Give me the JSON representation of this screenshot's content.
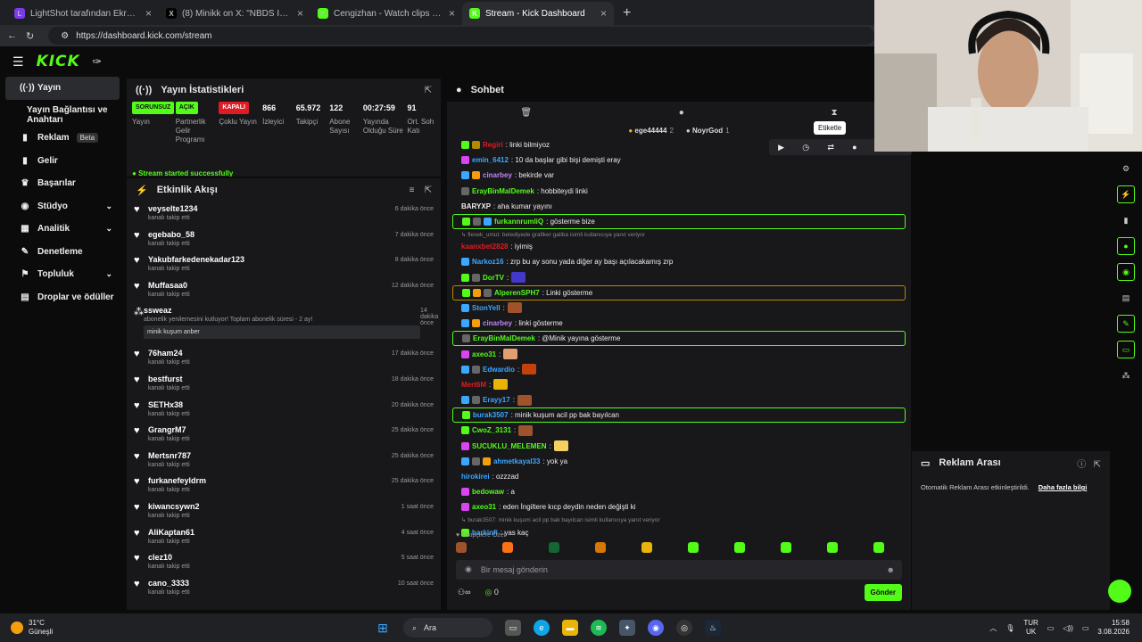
{
  "browser": {
    "tabs": [
      {
        "title": "LightShot tarafından Ekran Görünt",
        "fav": "L",
        "color": "#7c3aed",
        "active": false
      },
      {
        "title": "(8) Minikk on X: \"NBDS İFŞA ;) http",
        "fav": "X",
        "color": "#000000",
        "active": false
      },
      {
        "title": "Cengizhan - Watch clips on Kick",
        "fav": "K",
        "color": "#53fc18",
        "active": false
      },
      {
        "title": "Stream - Kick Dashboard",
        "fav": "K",
        "color": "#53fc18",
        "active": true
      }
    ],
    "url": "https://dashboard.kick.com/stream"
  },
  "header": {
    "logo": "KICK"
  },
  "sidebar": {
    "items": [
      {
        "label": "Yayın",
        "icon": "broadcast-icon",
        "glyph": "((·))",
        "active": true
      },
      {
        "label": "Yayın Bağlantısı ve Anahtarı",
        "icon": "",
        "glyph": "",
        "sub": true
      },
      {
        "label": "Reklam",
        "icon": "ad-icon",
        "glyph": "▮",
        "badge": "Beta"
      },
      {
        "label": "Gelir",
        "icon": "revenue-icon",
        "glyph": "▮"
      },
      {
        "label": "Başarılar",
        "icon": "trophy-icon",
        "glyph": "♛"
      },
      {
        "label": "Stüdyo",
        "icon": "studio-icon",
        "glyph": "◉",
        "chev": true
      },
      {
        "label": "Analitik",
        "icon": "analytics-icon",
        "glyph": "▦",
        "chev": true
      },
      {
        "label": "Denetleme",
        "icon": "moderation-icon",
        "glyph": "✎"
      },
      {
        "label": "Topluluk",
        "icon": "community-icon",
        "glyph": "⚑",
        "chev": true
      },
      {
        "label": "Droplar ve ödüller",
        "icon": "drops-icon",
        "glyph": "▤"
      }
    ]
  },
  "stats": {
    "title": "Yayın İstatistikleri",
    "items": [
      {
        "value": "SORUNSUZ",
        "label": "Yayın",
        "pill": "g"
      },
      {
        "value": "AÇIK",
        "label": "Partnerlik Gelir Programı",
        "pill": "g"
      },
      {
        "value": "KAPALI",
        "label": "Çoklu Yayın",
        "pill": "r"
      },
      {
        "value": "866",
        "label": "İzleyici"
      },
      {
        "value": "65.972",
        "label": "Takipçi"
      },
      {
        "value": "122",
        "label": "Abone Sayısı"
      },
      {
        "value": "00:27:59",
        "label": "Yayında Olduğu Süre"
      },
      {
        "value": "91",
        "label": "Ort. Soh Katı"
      }
    ],
    "status": "Stream started successfully"
  },
  "activity": {
    "title": "Etkinlik Akışı",
    "items": [
      {
        "name": "veyselte1234",
        "sub": "kanalı takip etti",
        "time": "6 dakika önce"
      },
      {
        "name": "egebabo_58",
        "sub": "kanalı takip etti",
        "time": "7 dakika önce"
      },
      {
        "name": "Yakubfarkedenekadar123",
        "sub": "kanalı takip etti",
        "time": "8 dakika önce"
      },
      {
        "name": "Muffasaa0",
        "sub": "kanalı takip etti",
        "time": "12 dakika önce"
      },
      {
        "name": "ssweaz",
        "sub": "abonelik yenilemesini kutluyor! Toplam abonelik süresi - 2 ay!",
        "time": "14 dakika önce",
        "box": "minik kuşum anber",
        "star": true
      },
      {
        "name": "76ham24",
        "sub": "kanalı takip etti",
        "time": "17 dakika önce"
      },
      {
        "name": "bestfurst",
        "sub": "kanalı takip etti",
        "time": "18 dakika önce"
      },
      {
        "name": "SETHx38",
        "sub": "kanalı takip etti",
        "time": "20 dakika önce"
      },
      {
        "name": "GrangrM7",
        "sub": "kanalı takip etti",
        "time": "25 dakika önce"
      },
      {
        "name": "Mertsnr787",
        "sub": "kanalı takip etti",
        "time": "25 dakika önce"
      },
      {
        "name": "furkanefeyldrm",
        "sub": "kanalı takip etti",
        "time": "25 dakika önce"
      },
      {
        "name": "kiwancsywn2",
        "sub": "kanalı takip etti",
        "time": "1 saat önce"
      },
      {
        "name": "AliKaptan61",
        "sub": "kanalı takip etti",
        "time": "4 saat önce"
      },
      {
        "name": "clez10",
        "sub": "kanalı takip etti",
        "time": "5 saat önce"
      },
      {
        "name": "cano_3333",
        "sub": "kanalı takip etti",
        "time": "10 saat önce"
      }
    ]
  },
  "chat": {
    "title": "Sohbet",
    "pinned": [
      {
        "name": "ege44444",
        "count": "2"
      },
      {
        "name": "NoyrGod",
        "count": "1"
      }
    ],
    "tooltip": "Etiketle",
    "messages": [
      {
        "user": "Regiri",
        "color": "#e01b24",
        "text": ": linki bilmiyoz",
        "badges": [
          "#53fc18",
          "#b48a00"
        ]
      },
      {
        "user": "emin_6412",
        "color": "#3ba7ff",
        "text": ": 10 da başlar gibi bişi demişti eray",
        "badges": [
          "#d946ef"
        ]
      },
      {
        "user": "cinarbey",
        "color": "#c084fc",
        "text": ": bekirde var",
        "badges": [
          "#3ba7ff",
          "#f59e0b"
        ]
      },
      {
        "user": "ErayBinMalDemek",
        "color": "#53fc18",
        "text": ": hobbiteydi linki",
        "badges": [
          "#666"
        ]
      },
      {
        "user": "BARYXP",
        "color": "#eee",
        "text": ": aha kumar yayını",
        "badges": []
      },
      {
        "user": "furkannrumliQ",
        "color": "#53fc18",
        "text": ": gösterme bize",
        "badges": [
          "#53fc18",
          "#666",
          "#3ba7ff"
        ],
        "hl": "hl"
      },
      {
        "sys": "↳ flesek_umut: belediyede grafiker galiba isimli kullanıcıya yanıt veriyor"
      },
      {
        "user": "kaanxbet2828",
        "color": "#e01b24",
        "text": ": iyimiş",
        "badges": []
      },
      {
        "user": "Narkoz16",
        "color": "#3ba7ff",
        "text": ": zrp bu ay sonu yada diğer ay başı açılacakamış zrp",
        "badges": [
          "#3ba7ff"
        ]
      },
      {
        "user": "DorTV",
        "color": "#53fc18",
        "text": ":",
        "badges": [
          "#53fc18",
          "#666"
        ],
        "emote": "#4338ca"
      },
      {
        "user": "AlperenSPH7",
        "color": "#53fc18",
        "text": ": Linki gösterme",
        "badges": [
          "#53fc18",
          "#f59e0b",
          "#666"
        ],
        "hl": "ylw"
      },
      {
        "user": "StonYell",
        "color": "#3ba7ff",
        "text": ":",
        "badges": [
          "#3ba7ff"
        ],
        "emote": "#a0522d"
      },
      {
        "user": "cinarbey",
        "color": "#c084fc",
        "text": ": linki gösterme",
        "badges": [
          "#3ba7ff",
          "#f59e0b"
        ]
      },
      {
        "user": "ErayBinMalDemek",
        "color": "#53fc18",
        "text": ": @Minik yayına gösterme",
        "badges": [
          "#666"
        ],
        "hl": "hl"
      },
      {
        "user": "axeo31",
        "color": "#53fc18",
        "text": ":",
        "badges": [
          "#d946ef"
        ],
        "emote": "#e0a070"
      },
      {
        "user": "Edwardio",
        "color": "#3ba7ff",
        "text": ":",
        "badges": [
          "#3ba7ff",
          "#666"
        ],
        "emote": "#c2410c"
      },
      {
        "user": "Mert6M",
        "color": "#e01b24",
        "text": ":",
        "badges": [],
        "emote": "#eab308"
      },
      {
        "user": "Erayy17",
        "color": "#3ba7ff",
        "text": ":",
        "badges": [
          "#3ba7ff",
          "#666"
        ],
        "emote": "#a0522d"
      },
      {
        "user": "burak3507",
        "color": "#3ba7ff",
        "text": ": minik kuşum acil pp bak bayılcan",
        "badges": [
          "#53fc18"
        ],
        "hl": "hl"
      },
      {
        "user": "CwoZ_3131",
        "color": "#53fc18",
        "text": ":",
        "badges": [
          "#53fc18"
        ],
        "emote": "#a0522d"
      },
      {
        "user": "SUCUKLU_MELEMEN",
        "color": "#53fc18",
        "text": ":",
        "badges": [
          "#d946ef"
        ],
        "emote": "#f5d061"
      },
      {
        "user": "ahmetkayal33",
        "color": "#3ba7ff",
        "text": ": yok ya",
        "badges": [
          "#3ba7ff",
          "#666",
          "#f59e0b"
        ]
      },
      {
        "user": "hirokirei",
        "color": "#3ba7ff",
        "text": ": ozzzad",
        "badges": []
      },
      {
        "user": "bedowaw",
        "color": "#53fc18",
        "text": ": a",
        "badges": [
          "#d946ef"
        ]
      },
      {
        "user": "axeo31",
        "color": "#53fc18",
        "text": ": eden İngiltere kıcp deydin neden değişti ki",
        "badges": [
          "#d946ef"
        ]
      },
      {
        "sys": "↳ burak3507: minik kuşum acil pp bak bayılcan isimli kullanıcıya yanıt veriyor"
      },
      {
        "user": "barkinfi",
        "color": "#3ba7ff",
        "text": ": yas kaç",
        "badges": [
          "#53fc18"
        ]
      }
    ],
    "followers_only": "♥ Takipçilere Özel",
    "input_placeholder": "Bir mesaj gönderin",
    "points": "0",
    "send": "Gönder"
  },
  "ad_break": {
    "title": "Reklam Arası",
    "text": "Otomatik Reklam Arası etkinleştirildi.",
    "link": "Daha fazla bilgi"
  },
  "taskbar": {
    "temp": "31°C",
    "weather": "Güneşli",
    "search": "Ara",
    "lang": "TUR",
    "region": "UK",
    "time": "15:58",
    "date": "3.08.2026"
  }
}
